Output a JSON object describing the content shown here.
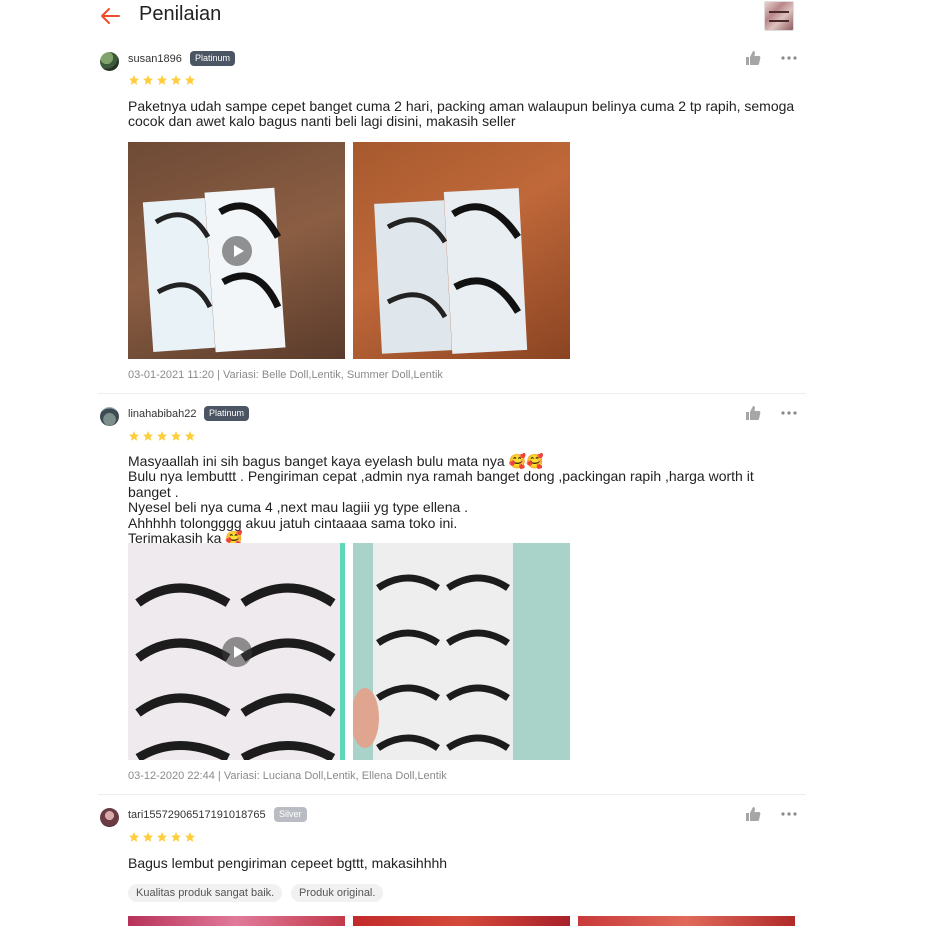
{
  "header": {
    "title": "Penilaian"
  },
  "reviews": [
    {
      "username": "susan1896",
      "tier": "Platinum",
      "rating": 5,
      "text": "Paketnya udah sampe cepet banget cuma 2 hari, packing aman walaupun belinya cuma 2 tp rapih, semoga cocok dan awet kalo bagus nanti beli lagi disini, makasih seller",
      "meta": "03-01-2021 11:20 | Variasi: Belle Doll,Lentik, Summer Doll,Lentik"
    },
    {
      "username": "linahabibah22",
      "tier": "Platinum",
      "rating": 5,
      "text": "Masyaallah ini sih bagus banget kaya eyelash bulu mata nya 🥰🥰\nBulu nya lembuttt . Pengiriman cepat ,admin nya ramah banget dong ,packingan rapih ,harga worth it banget .\nNyesel beli nya cuma 4 ,next mau lagiii yg type ellena .\nAhhhhh tolongggg akuu jatuh cintaaaa sama toko ini.\nTerimakasih ka 🥰",
      "meta": "03-12-2020 22:44 | Variasi: Luciana Doll,Lentik, Ellena Doll,Lentik"
    },
    {
      "username": "tari15572906517191018765",
      "tier": "Silver",
      "rating": 5,
      "text": "Bagus lembut pengiriman cepeet bgttt, makasihhhh",
      "tags": [
        "Kualitas produk sangat baik.",
        "Produk original."
      ]
    }
  ],
  "icons": {
    "back": "arrow-left-icon",
    "like": "thumbs-up-icon",
    "more": "more-dots-icon",
    "star": "star-icon",
    "play": "play-icon"
  },
  "colors": {
    "accent": "#ee4d2d",
    "star": "#ffce3d",
    "platinum_badge": "#4b5563",
    "silver_badge": "#b9bcc2",
    "meta_text": "#8a8a8a"
  }
}
